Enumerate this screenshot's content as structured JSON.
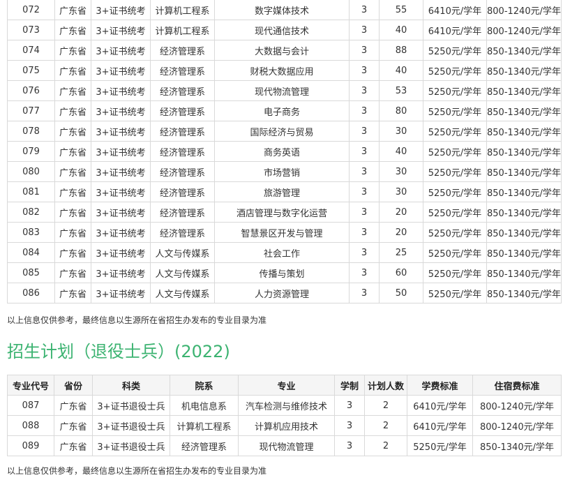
{
  "table1": {
    "rows": [
      [
        "072",
        "广东省",
        "3+证书统考",
        "计算机工程系",
        "数字媒体技术",
        "3",
        "55",
        "6410元/学年",
        "800-1240元/学年"
      ],
      [
        "073",
        "广东省",
        "3+证书统考",
        "计算机工程系",
        "现代通信技术",
        "3",
        "40",
        "6410元/学年",
        "800-1240元/学年"
      ],
      [
        "074",
        "广东省",
        "3+证书统考",
        "经济管理系",
        "大数据与会计",
        "3",
        "88",
        "5250元/学年",
        "850-1340元/学年"
      ],
      [
        "075",
        "广东省",
        "3+证书统考",
        "经济管理系",
        "财税大数据应用",
        "3",
        "40",
        "5250元/学年",
        "850-1340元/学年"
      ],
      [
        "076",
        "广东省",
        "3+证书统考",
        "经济管理系",
        "现代物流管理",
        "3",
        "53",
        "5250元/学年",
        "850-1340元/学年"
      ],
      [
        "077",
        "广东省",
        "3+证书统考",
        "经济管理系",
        "电子商务",
        "3",
        "80",
        "5250元/学年",
        "850-1340元/学年"
      ],
      [
        "078",
        "广东省",
        "3+证书统考",
        "经济管理系",
        "国际经济与贸易",
        "3",
        "30",
        "5250元/学年",
        "850-1340元/学年"
      ],
      [
        "079",
        "广东省",
        "3+证书统考",
        "经济管理系",
        "商务英语",
        "3",
        "40",
        "5250元/学年",
        "850-1340元/学年"
      ],
      [
        "080",
        "广东省",
        "3+证书统考",
        "经济管理系",
        "市场营销",
        "3",
        "30",
        "5250元/学年",
        "850-1340元/学年"
      ],
      [
        "081",
        "广东省",
        "3+证书统考",
        "经济管理系",
        "旅游管理",
        "3",
        "30",
        "5250元/学年",
        "850-1340元/学年"
      ],
      [
        "082",
        "广东省",
        "3+证书统考",
        "经济管理系",
        "酒店管理与数字化运营",
        "3",
        "20",
        "5250元/学年",
        "850-1340元/学年"
      ],
      [
        "083",
        "广东省",
        "3+证书统考",
        "经济管理系",
        "智慧景区开发与管理",
        "3",
        "20",
        "5250元/学年",
        "850-1340元/学年"
      ],
      [
        "084",
        "广东省",
        "3+证书统考",
        "人文与传媒系",
        "社会工作",
        "3",
        "25",
        "5250元/学年",
        "850-1340元/学年"
      ],
      [
        "085",
        "广东省",
        "3+证书统考",
        "人文与传媒系",
        "传播与策划",
        "3",
        "60",
        "5250元/学年",
        "850-1340元/学年"
      ],
      [
        "086",
        "广东省",
        "3+证书统考",
        "人文与传媒系",
        "人力资源管理",
        "3",
        "50",
        "5250元/学年",
        "850-1340元/学年"
      ]
    ]
  },
  "note1": "以上信息仅供参考，最终信息以生源所在省招生办发布的专业目录为准",
  "section2": {
    "title": "招生计划（退役士兵）(2022)",
    "headers": [
      "专业代号",
      "省份",
      "科类",
      "院系",
      "专业",
      "学制",
      "计划人数",
      "学费标准",
      "住宿费标准"
    ],
    "rows": [
      [
        "087",
        "广东省",
        "3+证书退役士兵",
        "机电信息系",
        "汽车检测与维修技术",
        "3",
        "2",
        "6410元/学年",
        "800-1240元/学年"
      ],
      [
        "088",
        "广东省",
        "3+证书退役士兵",
        "计算机工程系",
        "计算机应用技术",
        "3",
        "2",
        "6410元/学年",
        "800-1240元/学年"
      ],
      [
        "089",
        "广东省",
        "3+证书退役士兵",
        "经济管理系",
        "现代物流管理",
        "3",
        "2",
        "5250元/学年",
        "850-1340元/学年"
      ]
    ]
  },
  "note2": "以上信息仅供参考，最终信息以生源所在省招生办发布的专业目录为准",
  "colors": {
    "title": "#3cb371",
    "border": "#d9d9d9",
    "header_bg": "#f5f5f5"
  }
}
